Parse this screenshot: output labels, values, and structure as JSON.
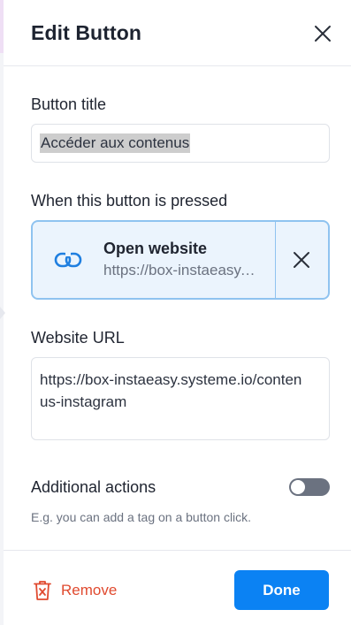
{
  "header": {
    "title": "Edit Button"
  },
  "button_title": {
    "label": "Button title",
    "value": "Accéder aux contenus"
  },
  "action": {
    "label": "When this button is pressed",
    "title": "Open website",
    "url_preview": "https://box-instaeasy.systeme.io/contenus-instagram"
  },
  "website_url": {
    "label": "Website URL",
    "value": "https://box-instaeasy.systeme.io/contenus-instagram"
  },
  "additional_actions": {
    "label": "Additional actions",
    "enabled": false,
    "hint": "E.g. you can add a tag on a button click."
  },
  "footer": {
    "remove_label": "Remove",
    "done_label": "Done"
  },
  "colors": {
    "primary": "#0b82f3",
    "danger": "#e04a2f",
    "action_bg": "#ebf4fd",
    "action_border": "#8fc3f0"
  }
}
